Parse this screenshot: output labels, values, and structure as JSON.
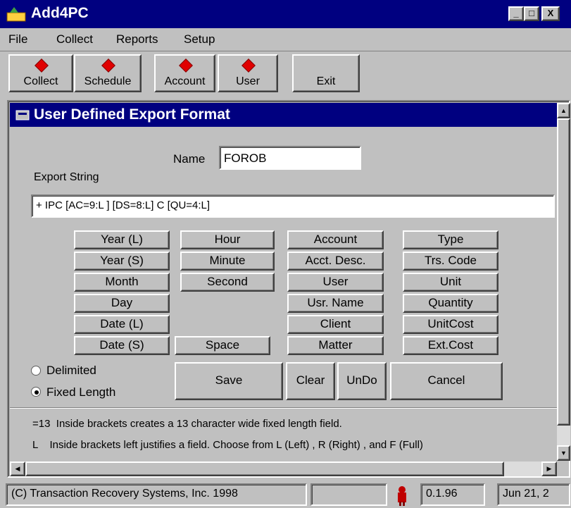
{
  "app": {
    "title": "Add4PC"
  },
  "window_buttons": {
    "minimize": "_",
    "maximize": "□",
    "close": "X"
  },
  "menu": [
    "File",
    "Collect",
    "Reports",
    "Setup"
  ],
  "toolbar": {
    "collect": "Collect",
    "schedule": "Schedule",
    "account": "Account",
    "user": "User",
    "exit": "Exit"
  },
  "dialog": {
    "title": "User Defined Export Format",
    "name_label": "Name",
    "name_value": "FOROB",
    "export_label": "Export String",
    "export_value": "+ IPC [AC=9:L ] [DS=8:L] C [QU=4:L]"
  },
  "fields": {
    "col1": [
      "Year (L)",
      "Year (S)",
      "Month",
      "Day",
      "Date (L)",
      "Date (S)"
    ],
    "col2": [
      "Hour",
      "Minute",
      "Second"
    ],
    "space": "Space",
    "col3": [
      "Account",
      "Acct. Desc.",
      "User",
      "Usr. Name",
      "Client",
      "Matter"
    ],
    "col4": [
      "Type",
      "Trs. Code",
      "Unit",
      "Quantity",
      "UnitCost",
      "Ext.Cost"
    ]
  },
  "format": {
    "delimited": "Delimited",
    "fixed_length": "Fixed Length",
    "selected": "fixed_length"
  },
  "actions": {
    "save": "Save",
    "clear": "Clear",
    "undo": "UnDo",
    "cancel": "Cancel"
  },
  "help": {
    "line1": "=13  Inside brackets creates a 13 character wide fixed length field.",
    "line2": "L    Inside brackets left justifies a field. Choose from L (Left) , R (Right) , and F (Full)"
  },
  "statusbar": {
    "copyright": "(C) Transaction Recovery Systems, Inc. 1998",
    "version": "0.1.96",
    "date": "Jun 21, 2"
  }
}
